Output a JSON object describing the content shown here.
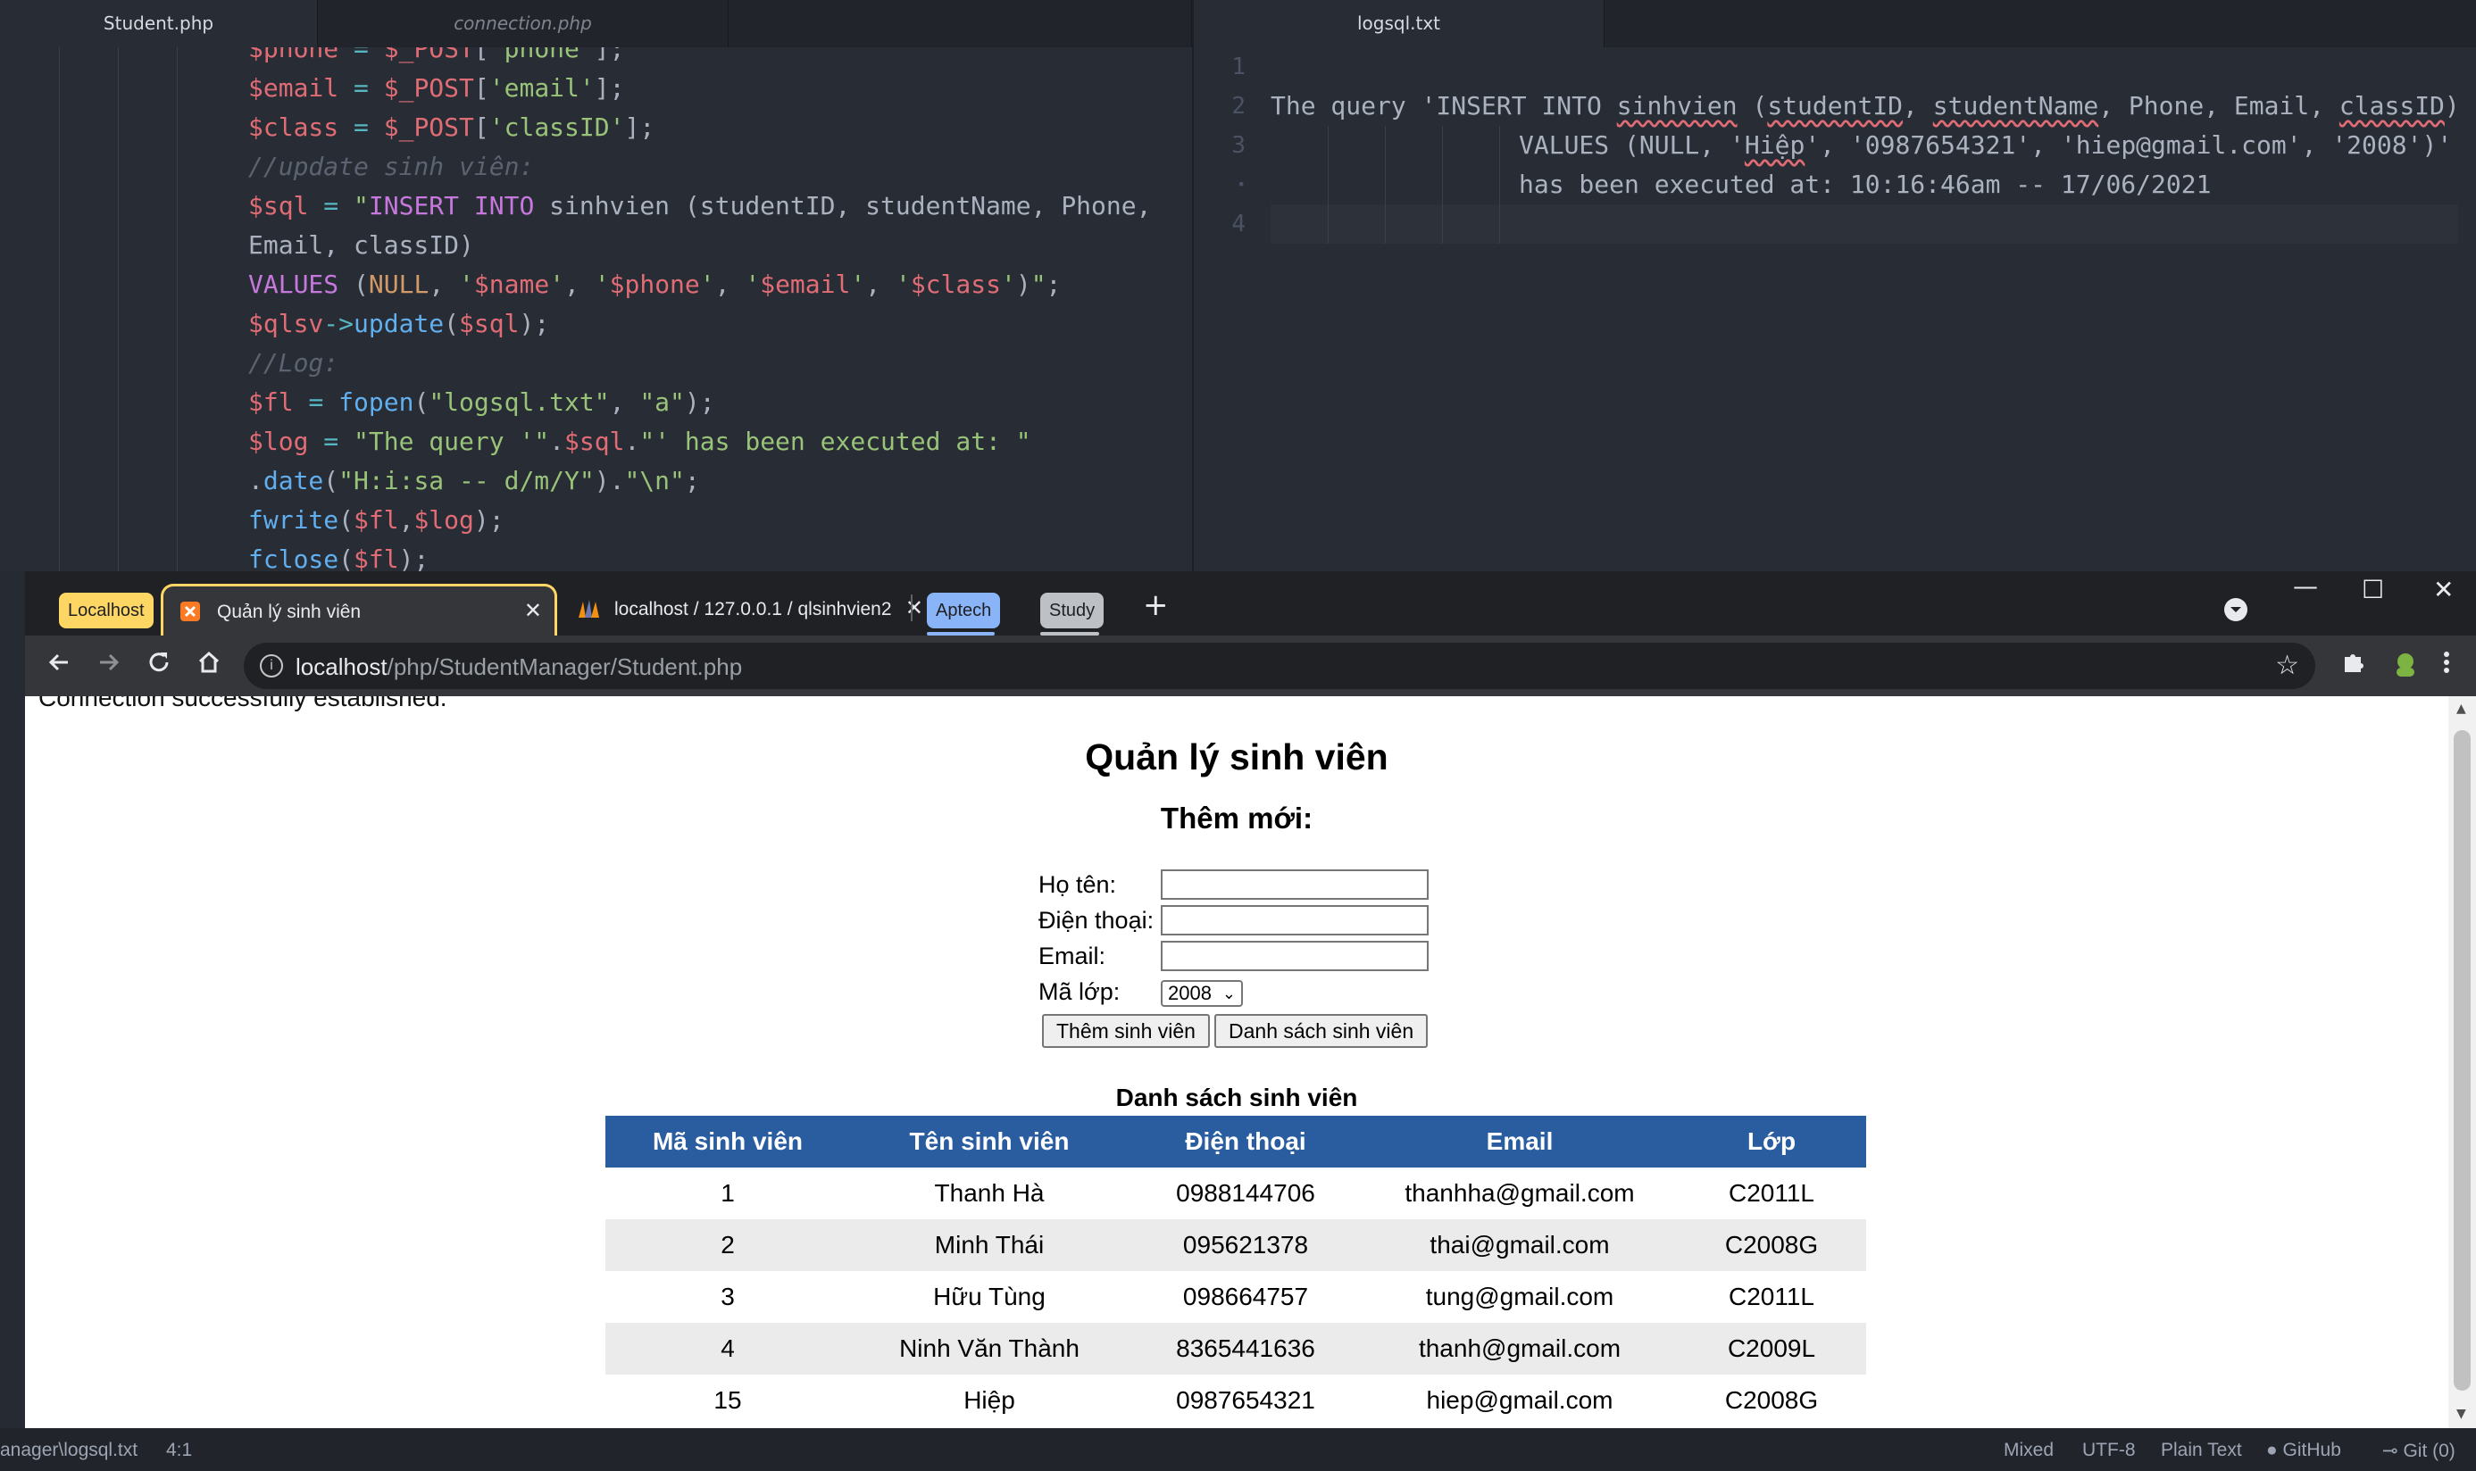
{
  "editor": {
    "tabs": [
      "Student.php",
      "connection.php",
      "logsql.txt"
    ],
    "line_numbers": [
      "1",
      "2",
      "3",
      "•",
      "4"
    ],
    "log": {
      "p1": "The query 'INSERT INTO ",
      "sinhvien": "sinhvien",
      "p2": " (",
      "studentID": "studentID",
      "p3": ", ",
      "studentName": "studentName",
      "p4": ", Phone, Email, ",
      "classID": "classID",
      "p5": ")",
      "l3a": "VALUES (NULL, '",
      "hiep": "Hiệp",
      "l3b": "', '0987654321', 'hiep@gmail.com', '2008')'",
      "l4": "has been executed at: 10:16:46am -- 17/06/2021"
    }
  },
  "browser": {
    "groups": [
      "Localhost",
      "Aptech",
      "Study"
    ],
    "tabs": [
      "Quản lý sinh viên",
      "localhost / 127.0.0.1 / qlsinhvien2"
    ],
    "url_host": "localhost",
    "url_path": "/php/StudentManager/Student.php"
  },
  "page": {
    "connection_msg": "Connection successfully established.",
    "title": "Quản lý sinh viên",
    "subtitle": "Thêm mới:",
    "form": {
      "name_label": "Họ tên:",
      "phone_label": "Điện thoại:",
      "email_label": "Email:",
      "class_label": "Mã lớp:",
      "class_value": "2008",
      "add_button": "Thêm sinh viên",
      "list_button": "Danh sách sinh viên"
    },
    "table_caption": "Danh sách sinh viên",
    "columns": [
      "Mã sinh viên",
      "Tên sinh viên",
      "Điện thoại",
      "Email",
      "Lớp"
    ],
    "rows": [
      [
        "1",
        "Thanh Hà",
        "0988144706",
        "thanhha@gmail.com",
        "C2011L"
      ],
      [
        "2",
        "Minh Thái",
        "095621378",
        "thai@gmail.com",
        "C2008G"
      ],
      [
        "3",
        "Hữu Tùng",
        "098664757",
        "tung@gmail.com",
        "C2011L"
      ],
      [
        "4",
        "Ninh Văn Thành",
        "8365441636",
        "thanh@gmail.com",
        "C2009L"
      ],
      [
        "15",
        "Hiệp",
        "0987654321",
        "hiep@gmail.com",
        "C2008G"
      ]
    ]
  },
  "statusbar": {
    "file": "anager\\logsql.txt",
    "cursor": "4:1",
    "line_ending": "Mixed",
    "encoding": "UTF-8",
    "grammar": "Plain Text",
    "github": "GitHub",
    "git": "Git (0)"
  }
}
